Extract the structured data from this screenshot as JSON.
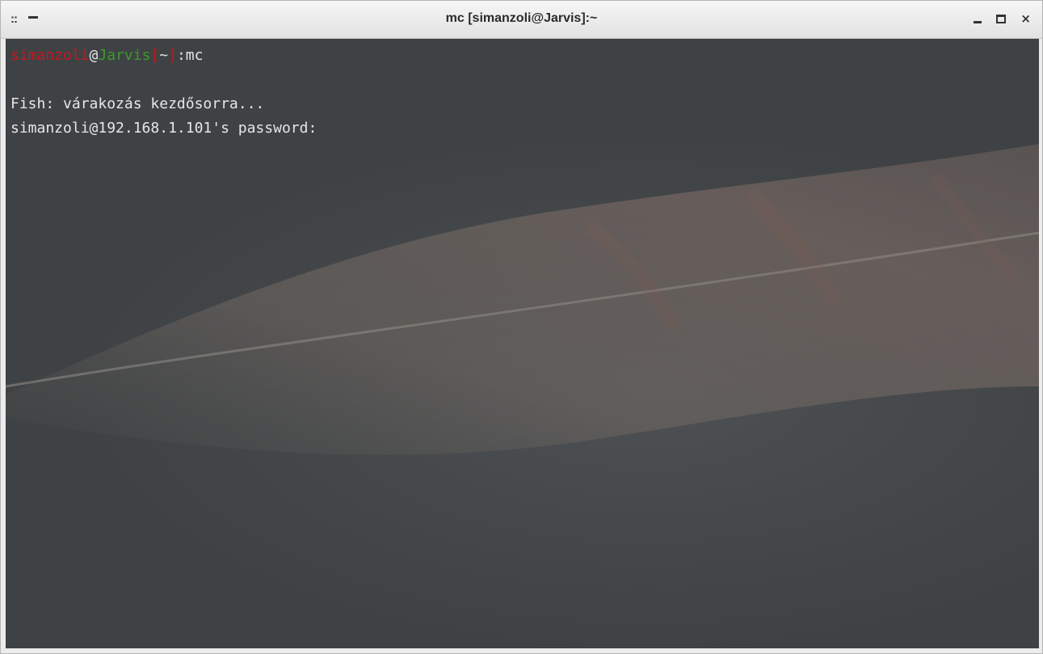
{
  "window": {
    "title": "mc [simanzoli@Jarvis]:~",
    "menu_glyph": "::",
    "close_glyph": "×"
  },
  "terminal": {
    "prompt": {
      "user": "simanzoli",
      "at": "@",
      "host": "Jarvis",
      "bracket_open": "[",
      "cwd": "~",
      "bracket_close": "]",
      "separator": ":",
      "command": "mc"
    },
    "lines": [
      "",
      "Fish: várakozás kezdősorra...",
      "simanzoli@192.168.1.101's password:"
    ],
    "colors": {
      "background": "#45484a",
      "text": "#e6e6e6",
      "user": "#c8161d",
      "host": "#3a9a2a"
    },
    "wallpaper": "feather"
  }
}
